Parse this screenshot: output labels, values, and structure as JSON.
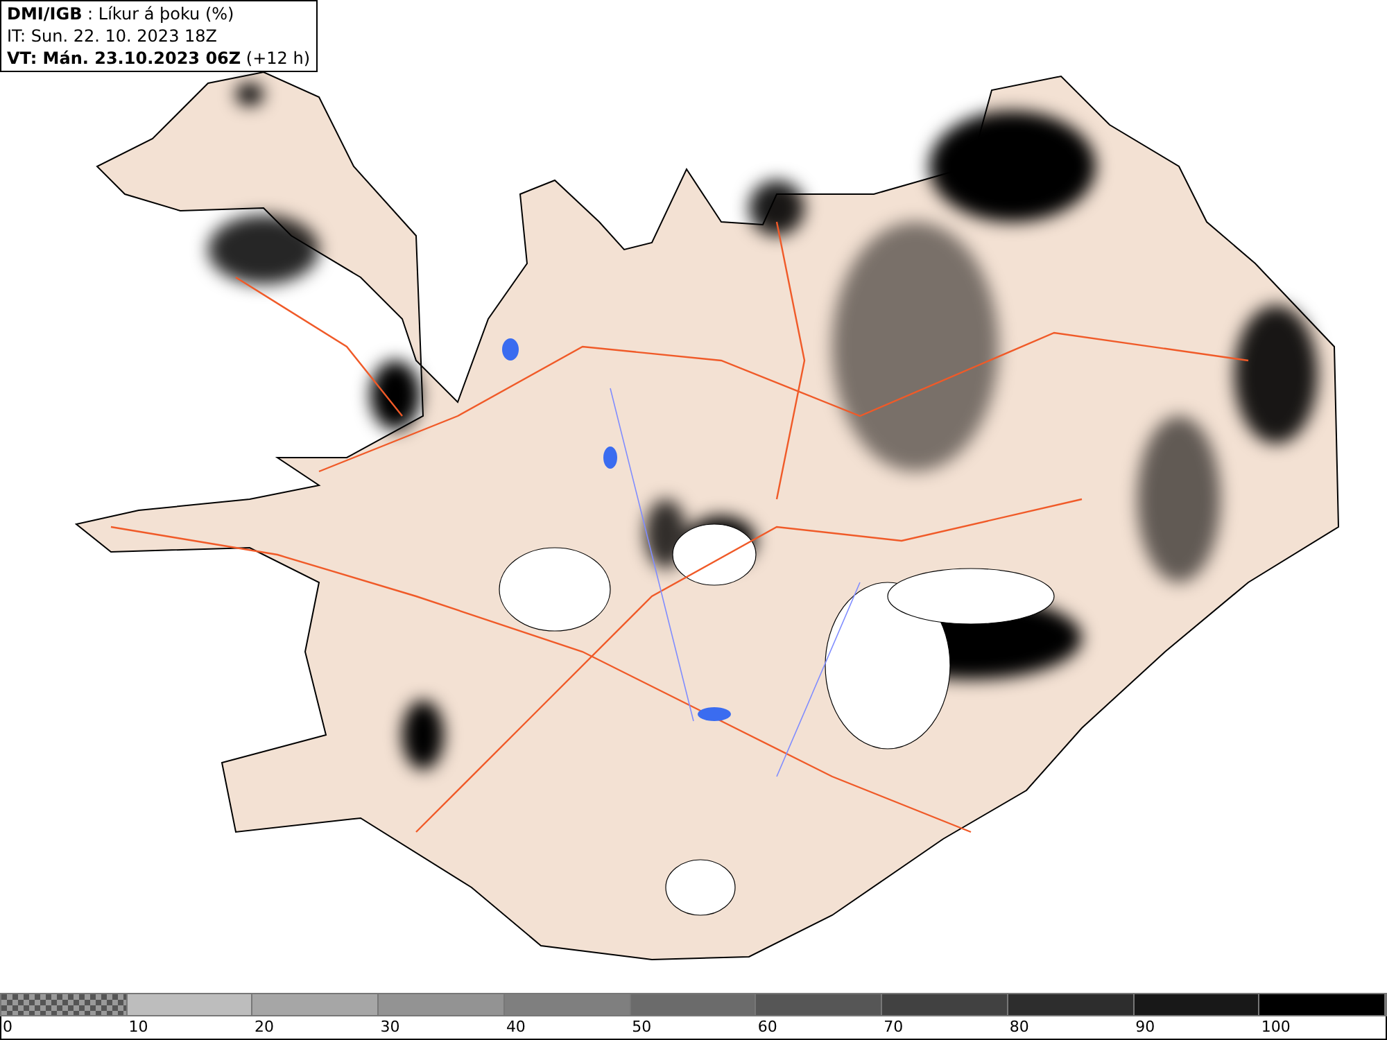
{
  "title_box": {
    "lines": [
      "**DMI/IGB** : Líkur á þoku (%)",
      "IT: Sun. 22. 10. 2023 18Z",
      "**VT: Mán. 23.10.2023 06Z** (+12 h)"
    ]
  },
  "legend": {
    "segments": [
      {
        "kind": "pattern",
        "color": "#9a9a9a",
        "label": "0"
      },
      {
        "kind": "solid",
        "color": "#bdbdbd",
        "label": "10"
      },
      {
        "kind": "solid",
        "color": "#a6a6a6",
        "label": "20"
      },
      {
        "kind": "solid",
        "color": "#939393",
        "label": "30"
      },
      {
        "kind": "solid",
        "color": "#7f7f7f",
        "label": "40"
      },
      {
        "kind": "solid",
        "color": "#6b6b6b",
        "label": "50"
      },
      {
        "kind": "solid",
        "color": "#565656",
        "label": "60"
      },
      {
        "kind": "solid",
        "color": "#414141",
        "label": "70"
      },
      {
        "kind": "solid",
        "color": "#2d2d2d",
        "label": "80"
      },
      {
        "kind": "solid",
        "color": "#181818",
        "label": "90"
      },
      {
        "kind": "solid",
        "color": "#000000",
        "label": "100"
      }
    ]
  }
}
